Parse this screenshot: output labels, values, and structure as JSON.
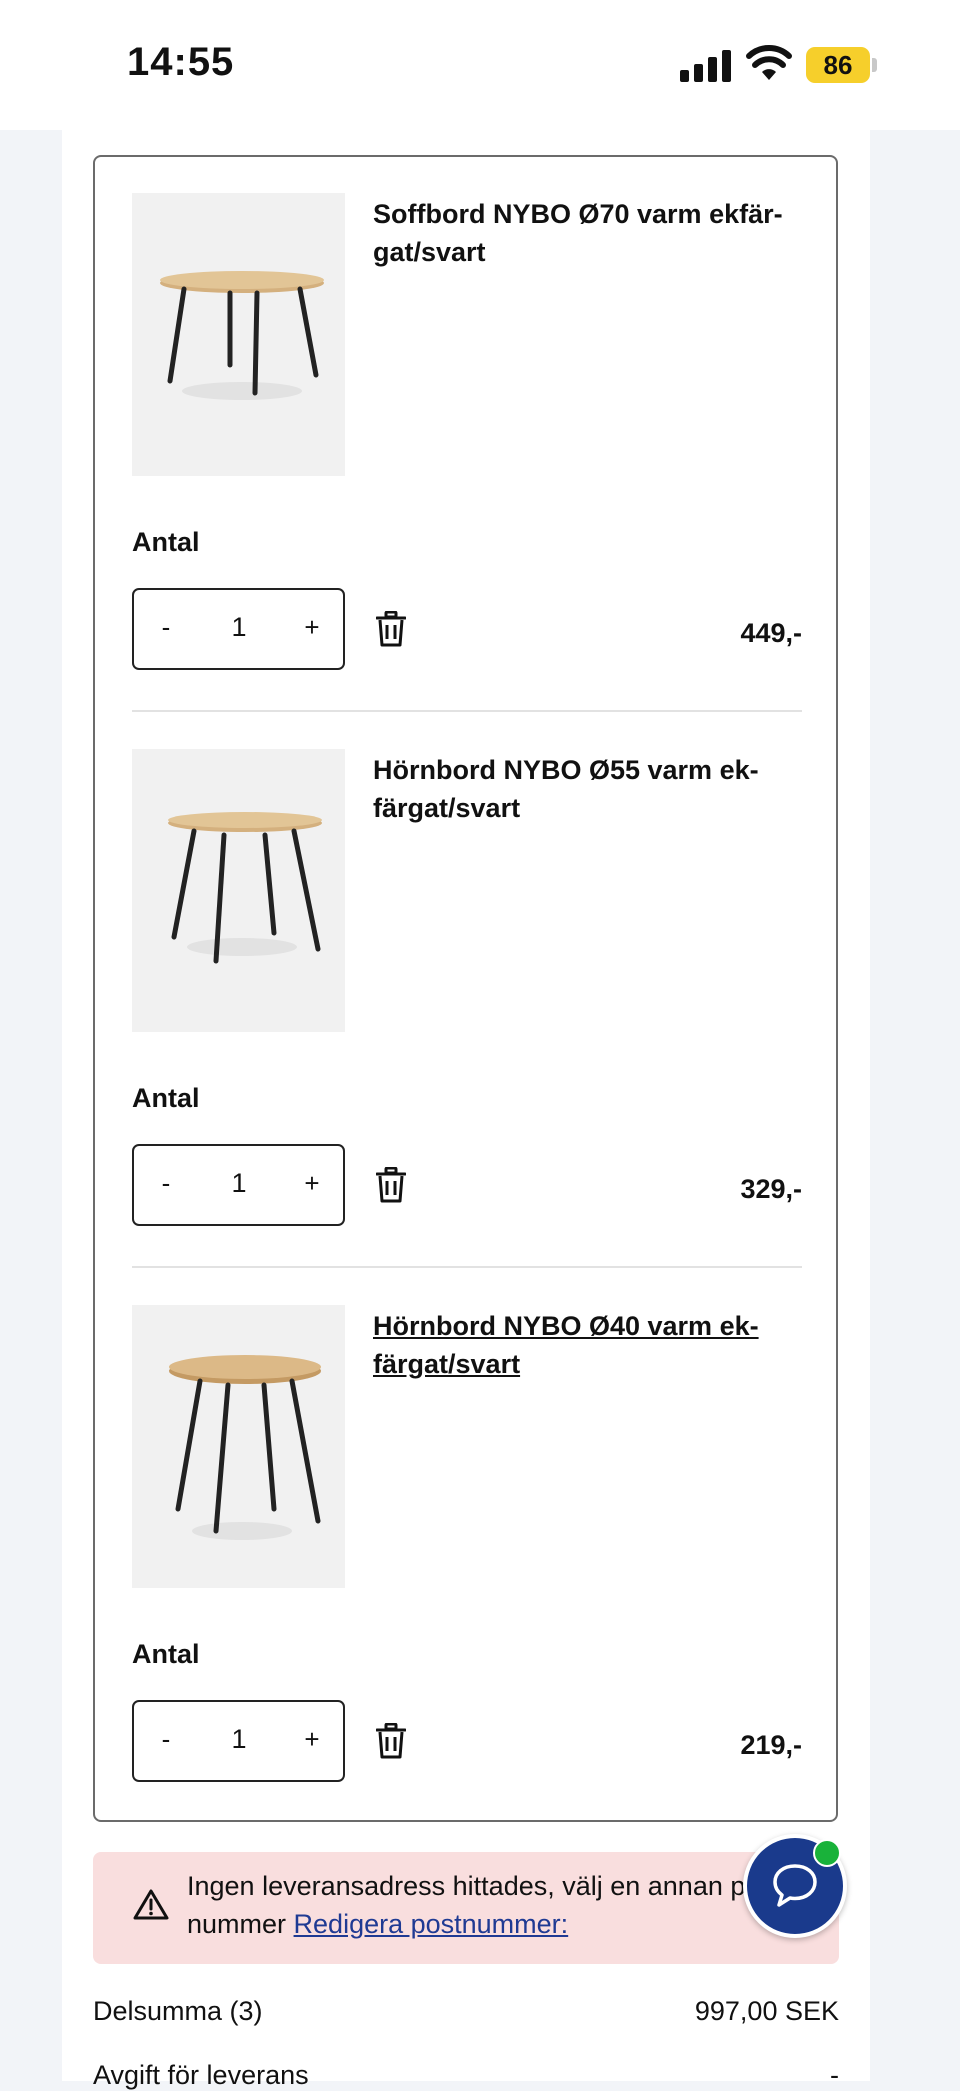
{
  "status_bar": {
    "time": "14:55",
    "battery": "86"
  },
  "cart": {
    "quantity_label": "Antal",
    "items": [
      {
        "title": "Soffbord NYBO Ø70 varm ekfär-gat/svart",
        "title_line1": "Soffbord NYBO Ø70 varm ekfär-",
        "title_line2": "gat/svart",
        "qty": "1",
        "price": "449,-",
        "decrement": "-",
        "increment": "+"
      },
      {
        "title": "Hörnbord NYBO Ø55 varm ek-färgat/svart",
        "title_line1": "Hörnbord NYBO Ø55 varm ek-",
        "title_line2": "färgat/svart",
        "qty": "1",
        "price": "329,-",
        "decrement": "-",
        "increment": "+"
      },
      {
        "title": "Hörnbord NYBO Ø40 varm ek-färgat/svart",
        "title_line1": "Hörnbord NYBO Ø40 varm ek-",
        "title_line2": "färgat/svart",
        "qty": "1",
        "price": "219,-",
        "decrement": "-",
        "increment": "+"
      }
    ]
  },
  "alert": {
    "text": "Ingen leveransadress hittades, välj en annan p",
    "text_line2": "nummer",
    "link": "Redigera postnummer:"
  },
  "summary": {
    "subtotal_label": "Delsumma (3)",
    "subtotal_value": "997,00 SEK",
    "delivery_label": "Avgift för leverans",
    "delivery_value": "-"
  },
  "colors": {
    "accent_blue": "#1a3a8c",
    "alert_bg": "#f9dede",
    "online_green": "#19b23a",
    "battery_yellow": "#f6cf2b"
  }
}
